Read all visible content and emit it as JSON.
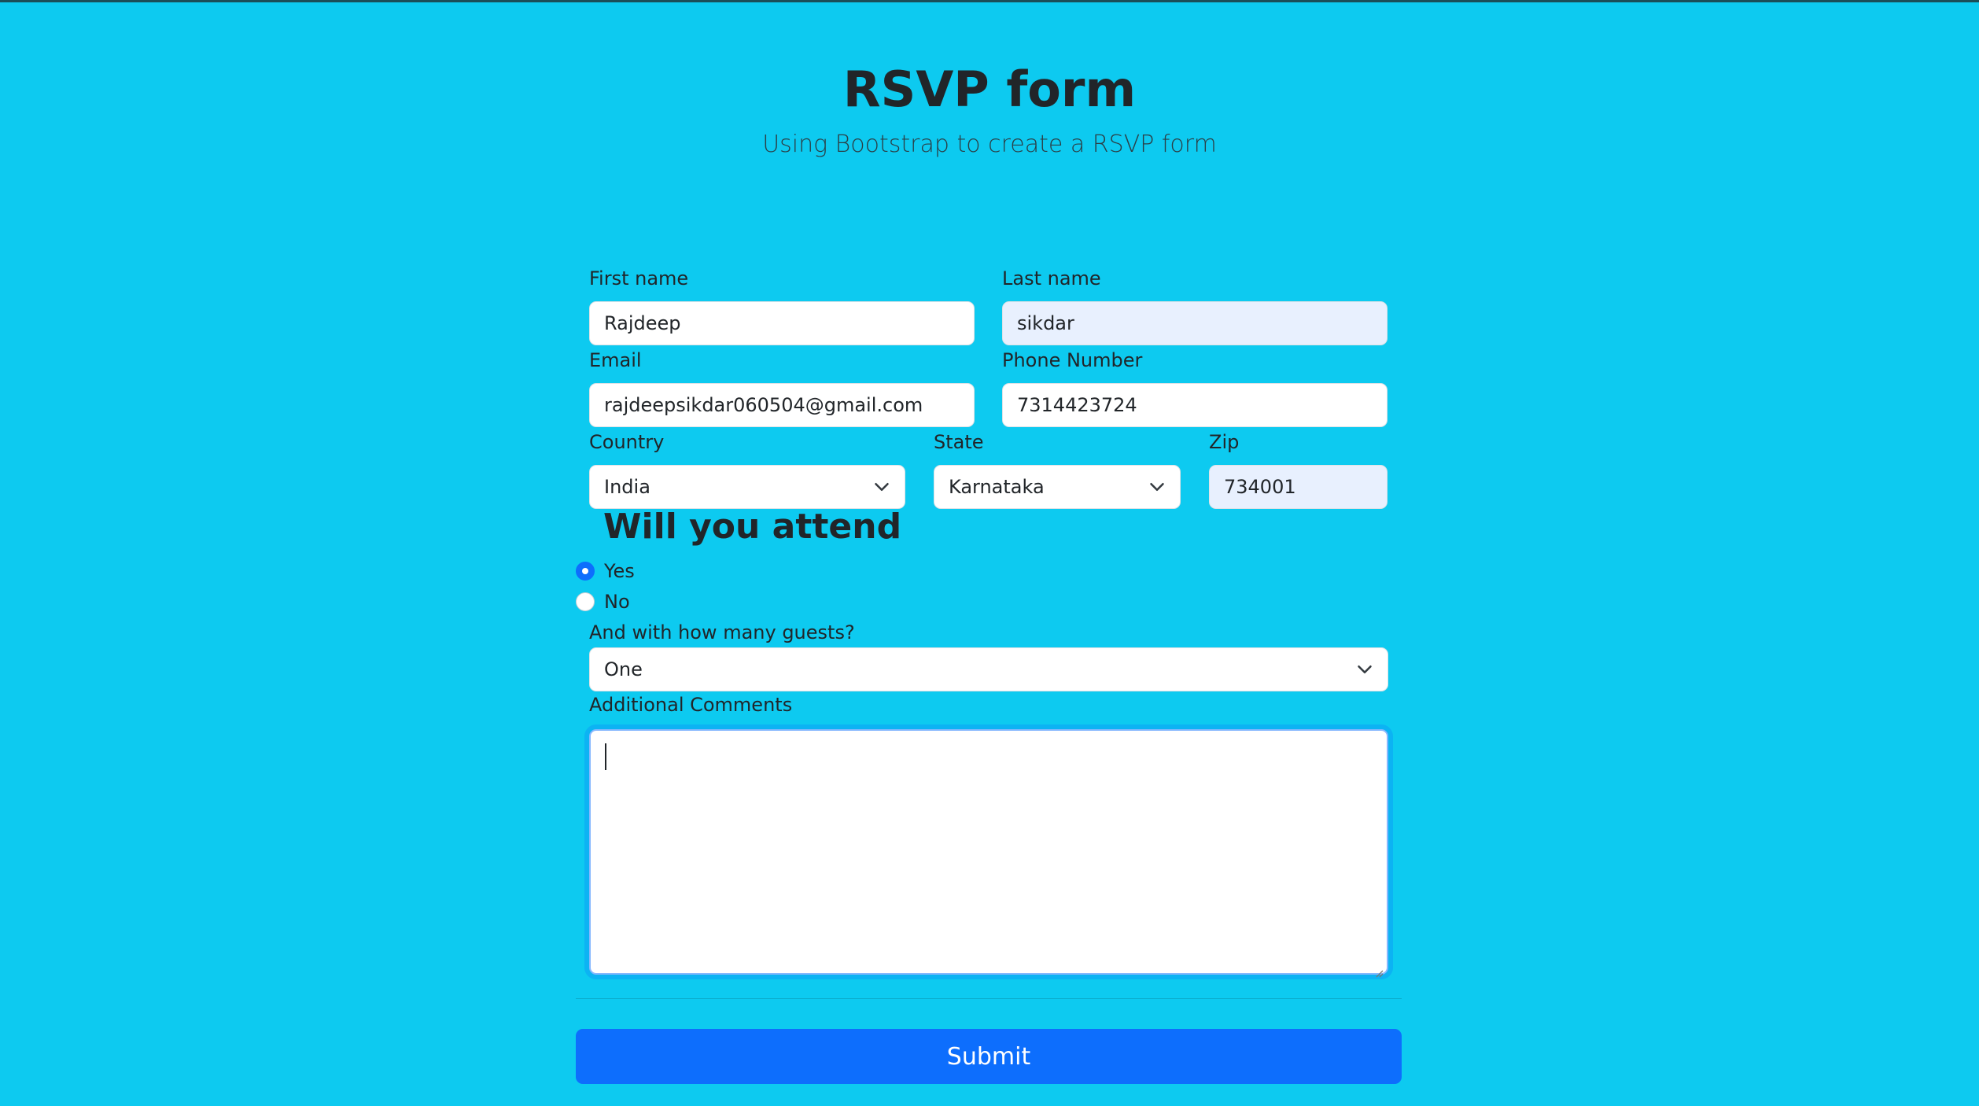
{
  "header": {
    "title": "RSVP form",
    "subtitle": "Using Bootstrap to create a RSVP form"
  },
  "form": {
    "first_name": {
      "label": "First name",
      "value": "Rajdeep"
    },
    "last_name": {
      "label": "Last name",
      "value": "sikdar"
    },
    "email": {
      "label": "Email",
      "value": "rajdeepsikdar060504@gmail.com"
    },
    "phone": {
      "label": "Phone Number",
      "value": "7314423724"
    },
    "country": {
      "label": "Country",
      "value": "India",
      "icon": "chevron-down-icon"
    },
    "state": {
      "label": "State",
      "value": "Karnataka",
      "icon": "chevron-down-icon"
    },
    "zip": {
      "label": "Zip",
      "value": "734001"
    },
    "attend": {
      "heading": "Will you attend",
      "options": [
        {
          "label": "Yes",
          "checked": true
        },
        {
          "label": "No",
          "checked": false
        }
      ]
    },
    "guests": {
      "label": "And with how many guests?",
      "value": "One",
      "icon": "chevron-down-icon"
    },
    "comments": {
      "label": "Additional Comments",
      "value": ""
    },
    "submit_label": "Submit"
  },
  "colors": {
    "background": "#0dcaf0",
    "primary": "#0d6efd",
    "autofill": "#e8f0fe"
  }
}
